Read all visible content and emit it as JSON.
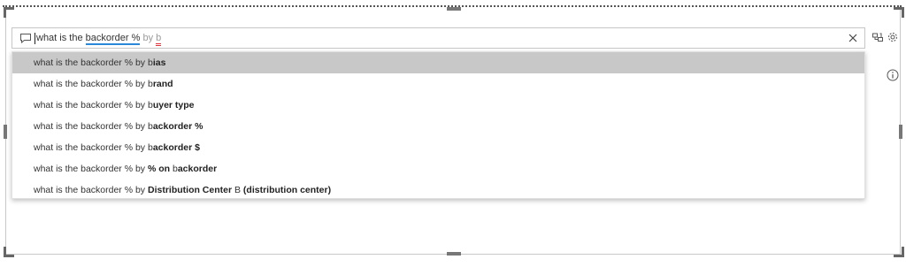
{
  "qa": {
    "query_prefix": "what is the ",
    "query_keyword": "backorder %",
    "query_by": " by ",
    "query_partial": "b",
    "clear_icon": "close-icon"
  },
  "toolbar": {
    "icons": [
      "sync-icon",
      "gear-icon"
    ]
  },
  "info_icon": "info-icon",
  "suggestions": [
    {
      "prefix": "what is the backorder % by ",
      "match": "b",
      "rest": "ias",
      "suffix": ""
    },
    {
      "prefix": "what is the backorder % by ",
      "match": "b",
      "rest": "rand",
      "suffix": ""
    },
    {
      "prefix": "what is the backorder % by ",
      "match": "b",
      "rest": "uyer type",
      "suffix": ""
    },
    {
      "prefix": "what is the backorder % by ",
      "match": "b",
      "rest": "ackorder %",
      "suffix": ""
    },
    {
      "prefix": "what is the backorder % by ",
      "match": "b",
      "rest": "ackorder $",
      "suffix": ""
    },
    {
      "prefix": "what is the backorder % by ",
      "match": "% on ",
      "rest": "b",
      "suffix": "ackorder"
    },
    {
      "prefix": "what is the backorder % by ",
      "match": "Distribution Center",
      "rest": " B ",
      "suffix": "(distribution center)"
    }
  ],
  "selected_index": 0,
  "colors": {
    "selected_row": "#c8c8c8",
    "keyword_underline": "#2b88d8",
    "error_underline": "#e0323c"
  }
}
